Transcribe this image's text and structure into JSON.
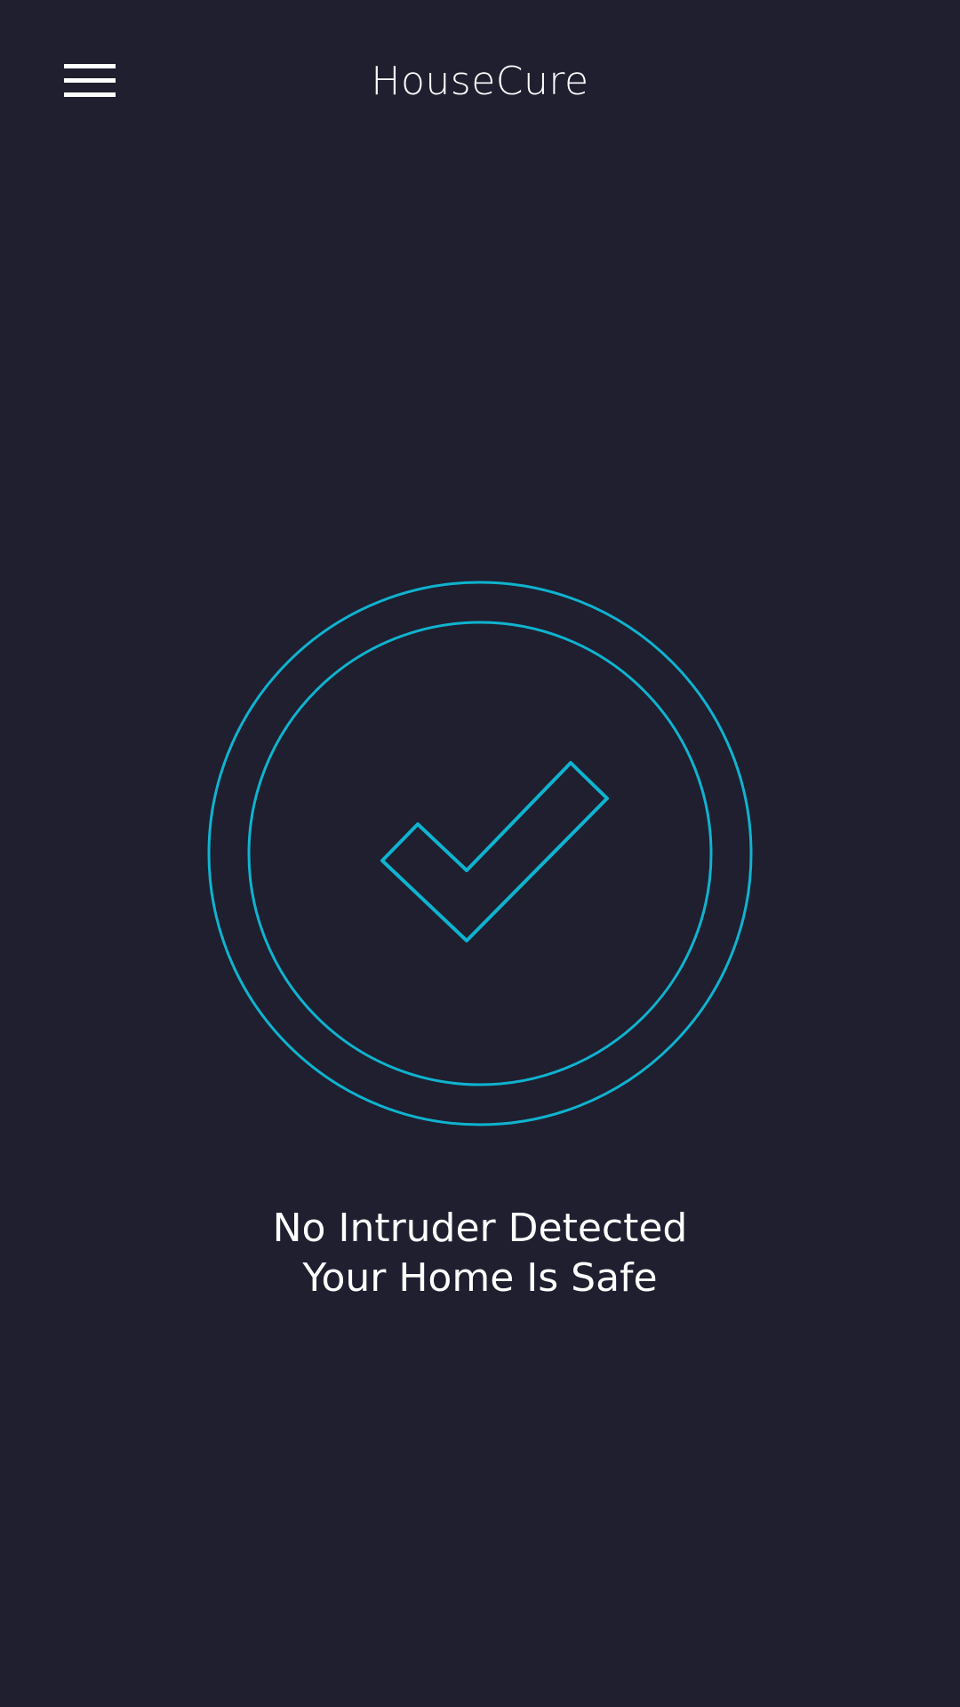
{
  "header": {
    "title": "HouseCure",
    "menu_icon": "hamburger-menu-icon"
  },
  "status": {
    "icon": "checkmark-shield-icon",
    "line1": "No Intruder Detected",
    "line2": "Your Home Is Safe"
  },
  "colors": {
    "background": "#1f1f30",
    "accent": "#0fb3cf",
    "text": "#ffffff"
  }
}
